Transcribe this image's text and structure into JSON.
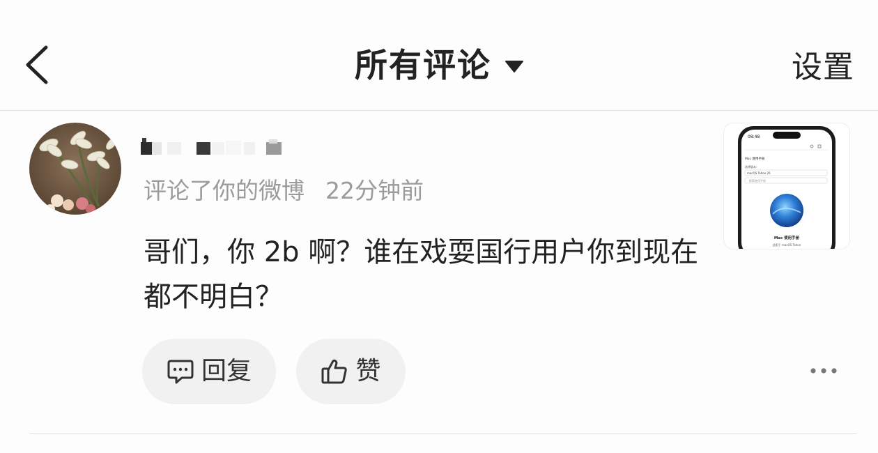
{
  "header": {
    "back_icon": "chevron-left-icon",
    "title": "所有评论",
    "dropdown_icon": "caret-down-icon",
    "settings_label": "设置"
  },
  "comment": {
    "author_name": "",
    "action": "评论了你的微博",
    "time": "22分钟前",
    "text": "哥们，你 2b 啊？谁在戏耍国行用户你到现在都不明白？",
    "reply_label": "回复",
    "reply_icon": "comment-icon",
    "like_label": "赞",
    "like_icon": "thumbs-up-icon",
    "more_icon": "more-dots-icon"
  },
  "thumbnail": {
    "status_time": "08:48",
    "page_heading": "Mac 使用手册",
    "select_label": "选择版本:",
    "select_value": "macOS Tahoe 26",
    "search_placeholder": "搜索使用手册",
    "book_title": "Mac 使用手册",
    "book_subtitle": "适用于 macOS Tahoe"
  },
  "colors": {
    "background": "#fdfdfd",
    "text_primary": "#222222",
    "text_secondary": "#9b9b9b",
    "button_bg": "#f1f1f1",
    "divider": "#e1e1e1"
  }
}
